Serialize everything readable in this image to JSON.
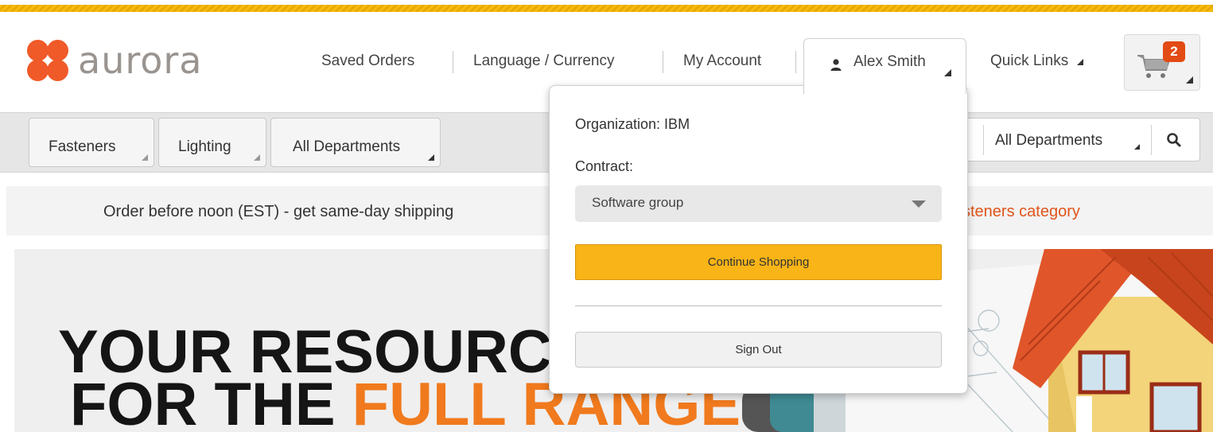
{
  "header": {
    "logo_text": "aurora",
    "links": [
      "Saved Orders",
      "Language / Currency",
      "My Account"
    ],
    "user_name": "Alex Smith",
    "quick_links": "Quick Links",
    "cart_count": "2"
  },
  "nav": {
    "categories": [
      "Fasteners",
      "Lighting",
      "All Departments"
    ],
    "search_department": "All Departments"
  },
  "promo": {
    "left": "Order before noon (EST) - get same-day shipping",
    "right": "steners category"
  },
  "hero": {
    "line1": "YOUR RESOURC",
    "line2_prefix": "FOR THE ",
    "line2_accent": "FULL RANGE"
  },
  "user_menu": {
    "organization": "Organization: IBM",
    "contract_label": "Contract:",
    "contract_value": "Software group",
    "continue_button": "Continue Shopping",
    "signout_button": "Sign Out"
  },
  "colors": {
    "accent_yellow": "#f9b417",
    "brand_orange": "#f05a28",
    "promo_orange": "#e0541a"
  }
}
